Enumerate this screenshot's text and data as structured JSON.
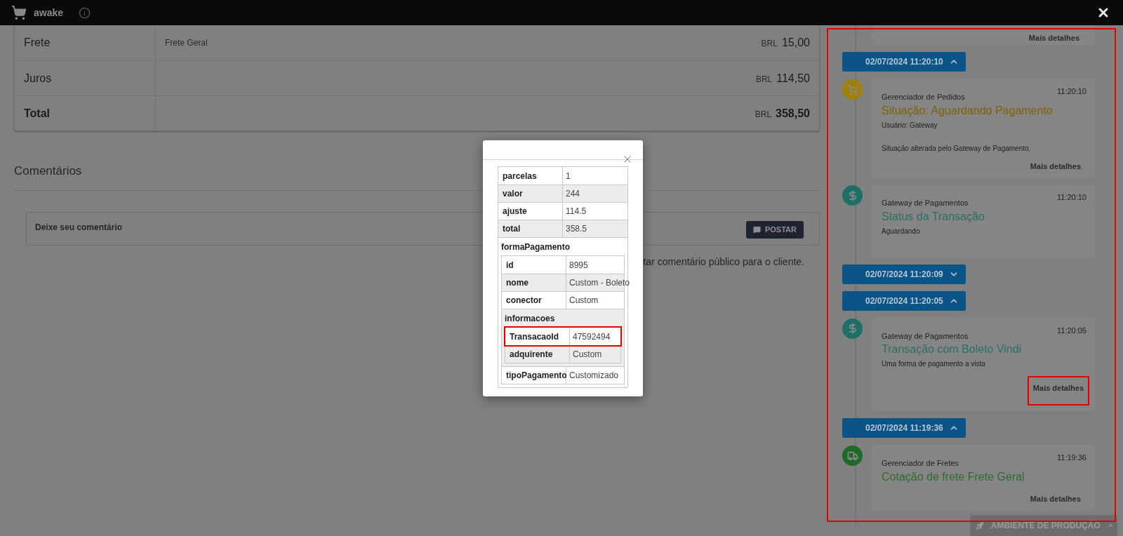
{
  "header": {
    "title": "awake"
  },
  "summary": {
    "rows": [
      {
        "label": "Frete",
        "detail": "Frete Geral",
        "currency": "BRL",
        "amount": "15,00",
        "bold": false
      },
      {
        "label": "Juros",
        "currency": "BRL",
        "amount": "114,50",
        "bold": false
      },
      {
        "label": "Total",
        "currency": "BRL",
        "amount": "358,50",
        "bold": true
      }
    ]
  },
  "comments": {
    "heading": "Comentários",
    "placeholder": "Deixe seu comentário",
    "button": "POSTAR",
    "note": "tar comentário público para o cliente."
  },
  "modal": {
    "rows": [
      {
        "key": "parcelas",
        "value": "1",
        "highlighted": false
      },
      {
        "key": "valor",
        "value": "244",
        "highlighted": false
      },
      {
        "key": "ajuste",
        "value": "114.5",
        "highlighted": false
      },
      {
        "key": "total",
        "value": "358.5",
        "highlighted": false
      },
      {
        "key": "formaPagamento",
        "children": [
          {
            "key": "id",
            "value": "8995",
            "highlighted": false
          },
          {
            "key": "nome",
            "value": "Custom - Boleto",
            "highlighted": false
          },
          {
            "key": "conector",
            "value": "Custom",
            "highlighted": false
          },
          {
            "key": "informacoes",
            "children": [
              {
                "key": "TransacaoId",
                "value": "47592494",
                "highlighted": true
              },
              {
                "key": "adquirente",
                "value": "Custom",
                "highlighted": false
              }
            ]
          },
          {
            "key": "tipoPagamento",
            "value": "Customizado",
            "highlighted": false
          }
        ]
      }
    ]
  },
  "timeline": {
    "top_link": "Mais detalhes",
    "groups": [
      {
        "date": "02/07/2024 11:20:10",
        "expanded": true,
        "events": [
          {
            "kind": "cart",
            "color": "#a08000",
            "source": "Gerenciador de Pedidos",
            "time": "11:20:10",
            "title": "Situação: Aguardando Pagamento",
            "lines": [
              "Usuário: Gateway",
              "Situação alterada pelo Gateway de Pagamento."
            ],
            "link": "Mais detalhes",
            "link_highlighted": false
          },
          {
            "kind": "dollar",
            "color": "#1e6f66",
            "source": "Gateway de Pagamentos",
            "time": "11:20:10",
            "title": "Status da Transação",
            "lines": [
              "Aguardando"
            ]
          }
        ]
      },
      {
        "date": "02/07/2024 11:20:09",
        "expanded": false
      },
      {
        "date": "02/07/2024 11:20:05",
        "expanded": true,
        "events": [
          {
            "kind": "dollar",
            "color": "#1e6f66",
            "source": "Gateway de Pagamentos",
            "time": "11:20:05",
            "title": "Transação com Boleto Vindi",
            "lines": [
              "Uma forma de pagamento a vista"
            ],
            "link": "Mais detalhes",
            "link_highlighted": true
          }
        ]
      },
      {
        "date": "02/07/2024 11:19:36",
        "expanded": true,
        "events": [
          {
            "kind": "truck",
            "color": "#1f6a2a",
            "source": "Gerenciador de Fretes",
            "time": "11:19:36",
            "title": "Cotação de frete Frete Geral",
            "link": "Mais detalhes",
            "link_highlighted": false
          }
        ]
      }
    ]
  },
  "environment": {
    "label": "AMBIENTE DE PRODUÇÃO"
  }
}
